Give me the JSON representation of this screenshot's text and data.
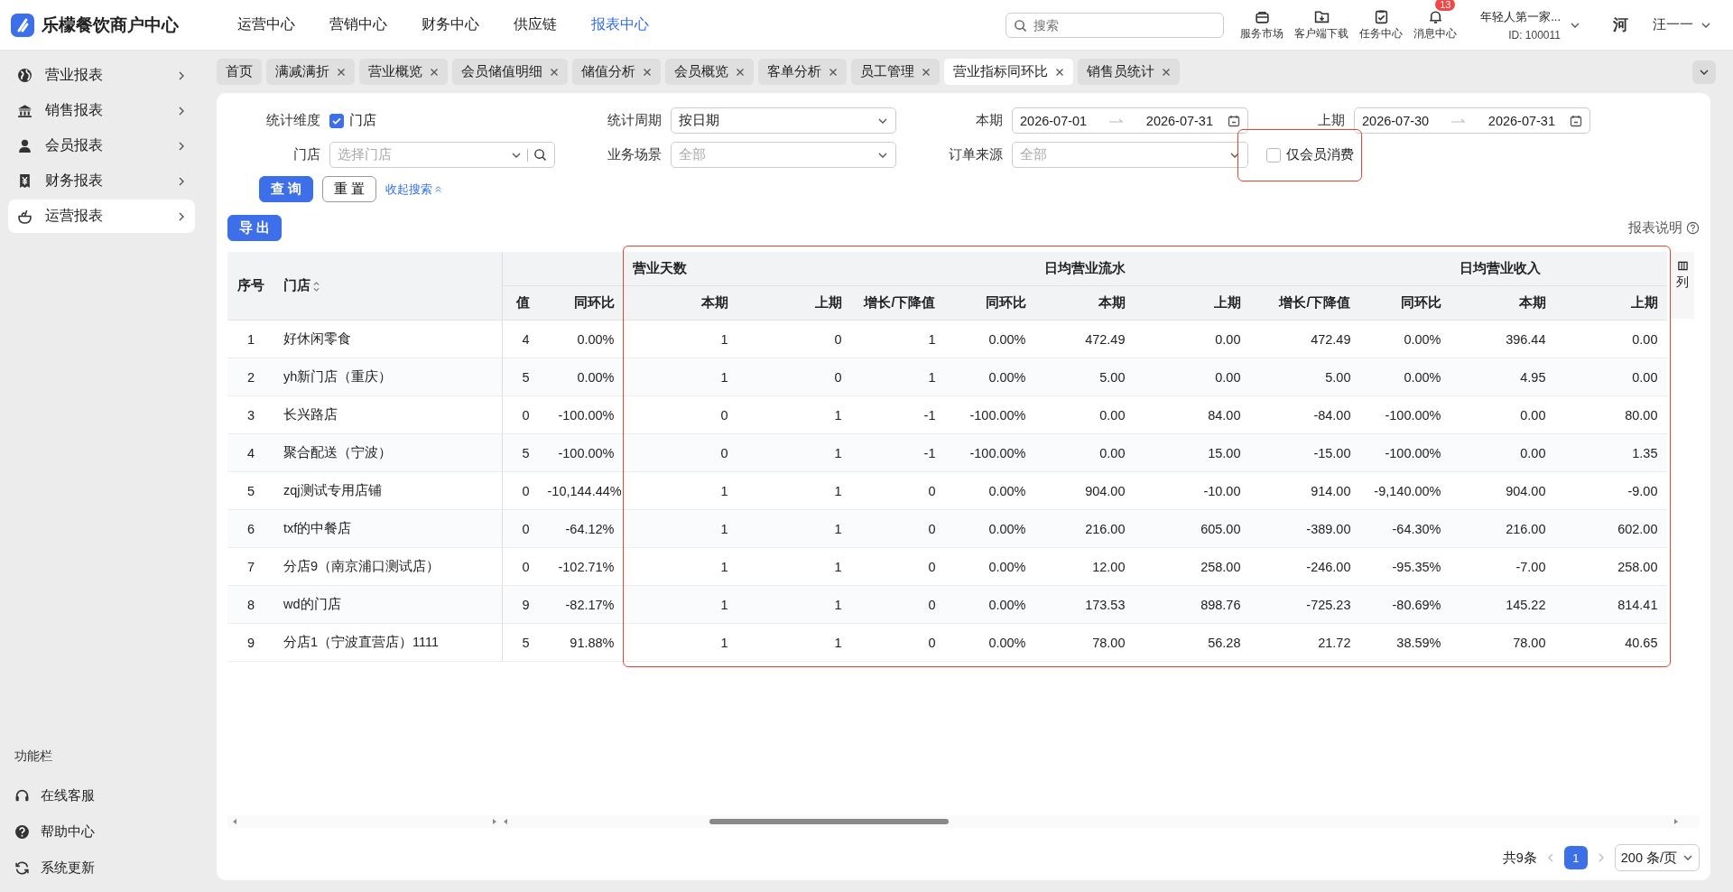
{
  "brand": {
    "name": "乐檬餐饮商户中心"
  },
  "top_nav": [
    {
      "label": "运营中心",
      "selected": false
    },
    {
      "label": "营销中心",
      "selected": false
    },
    {
      "label": "财务中心",
      "selected": false
    },
    {
      "label": "供应链",
      "selected": false
    },
    {
      "label": "报表中心",
      "selected": true
    }
  ],
  "search": {
    "placeholder": "搜索"
  },
  "tools": [
    {
      "kind": "bag",
      "label": "服务市场"
    },
    {
      "kind": "folder",
      "label": "客户端下载"
    },
    {
      "kind": "clipboard",
      "label": "任务中心"
    },
    {
      "kind": "bell",
      "label": "消息中心",
      "badge": "13"
    }
  ],
  "merchant": {
    "name": "年轻人第一家...",
    "id": "ID: 100011"
  },
  "user": {
    "avatar_text": "河",
    "name": "汪一一"
  },
  "sidebar": {
    "items": [
      {
        "kind": "globe",
        "label": "营业报表",
        "selected": false
      },
      {
        "kind": "bank",
        "label": "销售报表",
        "selected": false
      },
      {
        "kind": "person",
        "label": "会员报表",
        "selected": false
      },
      {
        "kind": "receipt",
        "label": "财务报表",
        "selected": false
      },
      {
        "kind": "bowl",
        "label": "运营报表",
        "selected": true
      }
    ],
    "footer_title": "功能栏",
    "footer_items": [
      {
        "kind": "headset",
        "label": "在线客服"
      },
      {
        "kind": "help",
        "label": "帮助中心"
      },
      {
        "kind": "refresh",
        "label": "系统更新"
      }
    ]
  },
  "tabs": [
    {
      "label": "首页",
      "closable": false,
      "selected": false
    },
    {
      "label": "满减满折",
      "closable": true,
      "selected": false
    },
    {
      "label": "营业概览",
      "closable": true,
      "selected": false
    },
    {
      "label": "会员储值明细",
      "closable": true,
      "selected": false
    },
    {
      "label": "储值分析",
      "closable": true,
      "selected": false
    },
    {
      "label": "会员概览",
      "closable": true,
      "selected": false
    },
    {
      "label": "客单分析",
      "closable": true,
      "selected": false
    },
    {
      "label": "员工管理",
      "closable": true,
      "selected": false
    },
    {
      "label": "营业指标同环比",
      "closable": true,
      "selected": true
    },
    {
      "label": "销售员统计",
      "closable": true,
      "selected": false
    }
  ],
  "filters": [
    {
      "kind": "checkbox",
      "label": "统计维度",
      "option": "门店",
      "checked": true
    },
    {
      "kind": "select",
      "label": "统计周期",
      "value": "按日期"
    },
    {
      "kind": "range",
      "label": "本期",
      "start": "2026-07-01",
      "end": "2026-07-31"
    },
    {
      "kind": "range",
      "label": "上期",
      "start": "2026-07-30",
      "end": "2026-07-31"
    },
    {
      "kind": "search-select",
      "label": "门店",
      "placeholder": "选择门店"
    },
    {
      "kind": "select",
      "label": "业务场景",
      "placeholder": "全部"
    },
    {
      "kind": "select",
      "label": "订单来源",
      "placeholder": "全部"
    },
    {
      "kind": "lone-checkbox",
      "option": "仅会员消费",
      "checked": false,
      "highlighted": true
    }
  ],
  "actions": {
    "query": "查 询",
    "reset": "重 置",
    "collapse": "收起搜索"
  },
  "export_button": "导 出",
  "report_help": "报表说明",
  "table": {
    "highlighted": true,
    "fixed_columns": [
      {
        "label": "序号",
        "sortable": false
      },
      {
        "label": "门店",
        "sortable": true
      }
    ],
    "groups": [
      {
        "columns": [
          "值",
          "同环比"
        ]
      },
      {
        "label": "营业天数",
        "columns": [
          "本期",
          "上期",
          "增长/下降值",
          "同环比"
        ]
      },
      {
        "label": "日均营业流水",
        "columns": [
          "本期",
          "上期",
          "增长/下降值",
          "同环比"
        ]
      },
      {
        "label": "日均营业收入",
        "columns": [
          "本期",
          "上期"
        ]
      }
    ],
    "settings_label": "列",
    "rows": [
      [
        "1",
        "好休闲零食",
        "4",
        "0.00%",
        "1",
        "0",
        "1",
        "0.00%",
        "472.49",
        "0.00",
        "472.49",
        "0.00%",
        "396.44",
        "0.00"
      ],
      [
        "2",
        "yh新门店（重庆）",
        "5",
        "0.00%",
        "1",
        "0",
        "1",
        "0.00%",
        "5.00",
        "0.00",
        "5.00",
        "0.00%",
        "4.95",
        "0.00"
      ],
      [
        "3",
        "长兴路店",
        "0",
        "-100.00%",
        "0",
        "1",
        "-1",
        "-100.00%",
        "0.00",
        "84.00",
        "-84.00",
        "-100.00%",
        "0.00",
        "80.00"
      ],
      [
        "4",
        "聚合配送（宁波）",
        "5",
        "-100.00%",
        "0",
        "1",
        "-1",
        "-100.00%",
        "0.00",
        "15.00",
        "-15.00",
        "-100.00%",
        "0.00",
        "1.35"
      ],
      [
        "5",
        "zqj测试专用店铺",
        "0",
        "-10,144.44%",
        "1",
        "1",
        "0",
        "0.00%",
        "904.00",
        "-10.00",
        "914.00",
        "-9,140.00%",
        "904.00",
        "-9.00"
      ],
      [
        "6",
        "txf的中餐店",
        "0",
        "-64.12%",
        "1",
        "1",
        "0",
        "0.00%",
        "216.00",
        "605.00",
        "-389.00",
        "-64.30%",
        "216.00",
        "602.00"
      ],
      [
        "7",
        "分店9（南京浦口测试店）",
        "0",
        "-102.71%",
        "1",
        "1",
        "0",
        "0.00%",
        "12.00",
        "258.00",
        "-246.00",
        "-95.35%",
        "-7.00",
        "258.00"
      ],
      [
        "8",
        "wd的门店",
        "9",
        "-82.17%",
        "1",
        "1",
        "0",
        "0.00%",
        "173.53",
        "898.76",
        "-725.23",
        "-80.69%",
        "145.22",
        "814.41"
      ],
      [
        "9",
        "分店1（宁波直营店）1111",
        "5",
        "91.88%",
        "1",
        "1",
        "0",
        "0.00%",
        "78.00",
        "56.28",
        "21.72",
        "38.59%",
        "78.00",
        "40.65"
      ]
    ]
  },
  "pagination": {
    "total": "共9条",
    "pages": [
      {
        "label": "1",
        "selected": true
      }
    ],
    "page_size": "200 条/页"
  }
}
